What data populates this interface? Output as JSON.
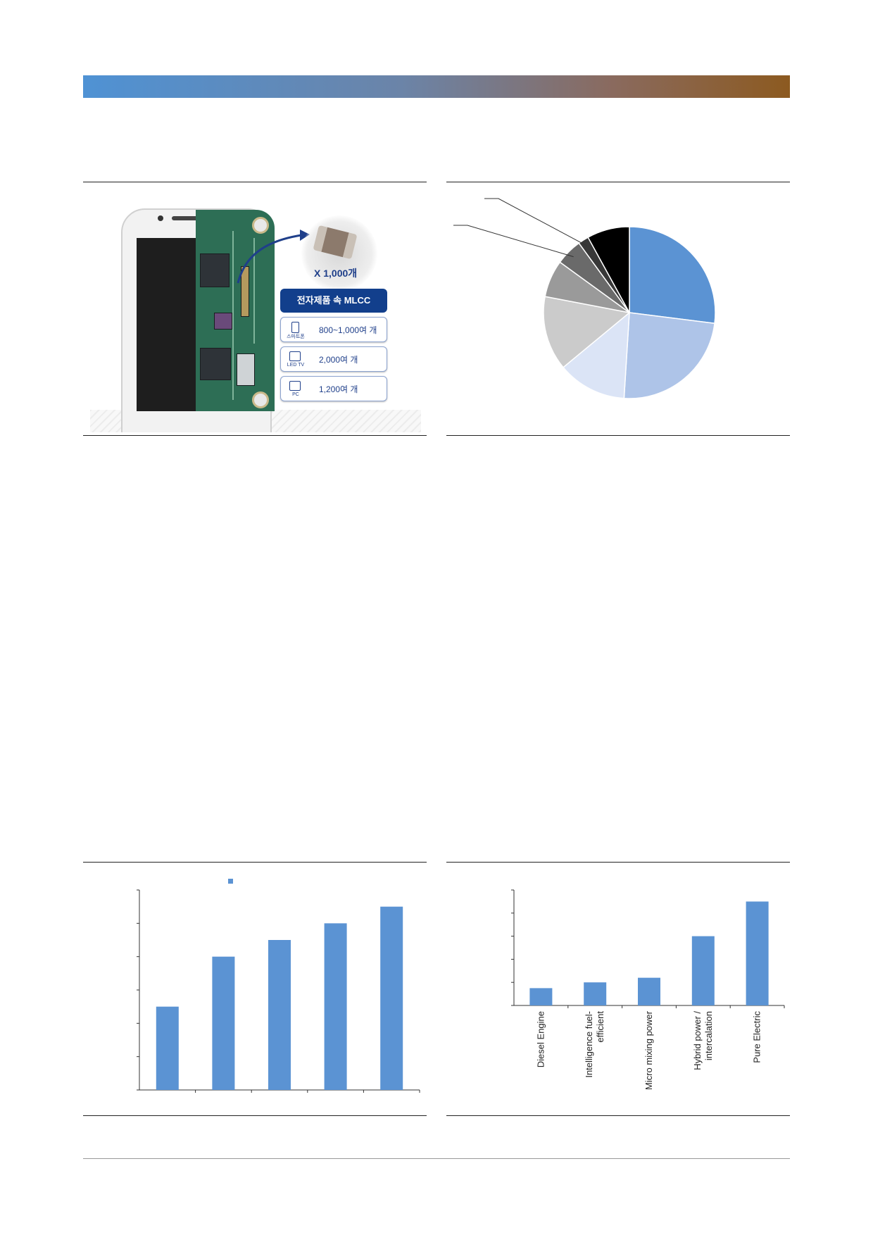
{
  "infographic": {
    "count_label": "X 1,000개",
    "header": "전자제품 속 MLCC",
    "rows": [
      {
        "icon": "smartphone-icon",
        "caption": "스마트폰",
        "value": "800~1,000여 개"
      },
      {
        "icon": "tv-icon",
        "caption": "LED TV",
        "value": "2,000여 개"
      },
      {
        "icon": "pc-icon",
        "caption": "PC",
        "value": "1,200여 개"
      }
    ]
  },
  "colors": {
    "bar": "#5b93d3",
    "pie": [
      "#5b93d3",
      "#aec4e8",
      "#dbe4f6",
      "#cbcbcb",
      "#9a9a9a",
      "#6a6a6a",
      "#383838",
      "#000000"
    ]
  },
  "chart_data": [
    {
      "type": "pie",
      "values": [
        27,
        24,
        13,
        14,
        7,
        5,
        2,
        8
      ],
      "start": "top, clockwise",
      "leader_lines": 2
    },
    {
      "type": "bar",
      "categories": [
        "",
        "",
        "",
        "",
        ""
      ],
      "values": [
        2.5,
        4.0,
        4.5,
        5.0,
        5.5
      ],
      "ylim": [
        0,
        6
      ],
      "yticks": 6,
      "legend": "top"
    },
    {
      "type": "bar",
      "categories": [
        "Diesel Engine",
        "Intelligence fuel-efficient",
        "Micro mixing power",
        "Hybrid power / intercalation",
        "Pure Electric"
      ],
      "values": [
        0.75,
        1.0,
        1.2,
        3.0,
        4.5
      ],
      "ylim": [
        0,
        5
      ],
      "yticks": 5
    }
  ]
}
